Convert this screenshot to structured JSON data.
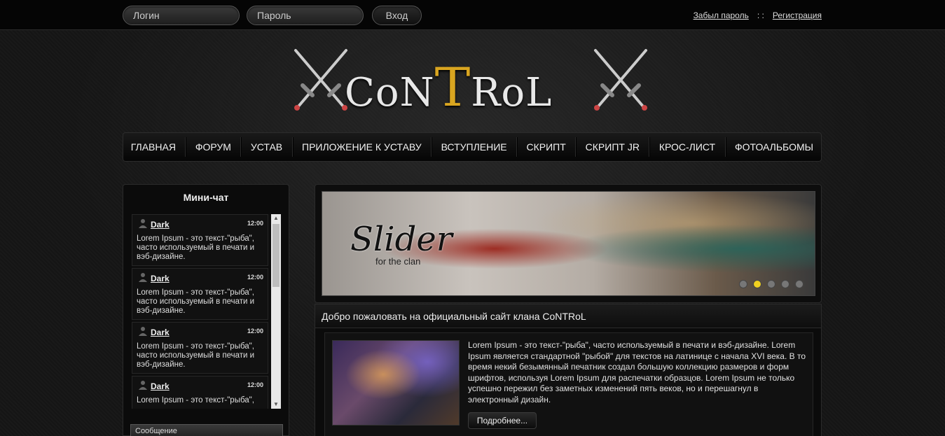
{
  "topbar": {
    "login_placeholder": "Логин",
    "password_placeholder": "Пароль",
    "login_button": "Вход",
    "forgot_password": "Забыл пароль",
    "separator": ": :",
    "register": "Регистрация"
  },
  "logo": {
    "part1": "CoN",
    "part2": "T",
    "part3": "RoL"
  },
  "nav": {
    "items": [
      "ГЛАВНАЯ",
      "ФОРУМ",
      "УСТАВ",
      "ПРИЛОЖЕНИЕ К УСТАВУ",
      "ВСТУПЛЕНИЕ",
      "СКРИПТ",
      "СКРИПТ JR",
      "КРОС-ЛИСТ",
      "ФОТОАЛЬБОМЫ"
    ]
  },
  "minichat": {
    "title": "Мини-чат",
    "messages": [
      {
        "user": "Dark",
        "time": "12:00",
        "text": "Lorem Ipsum - это текст-\"рыба\", часто используемый в печати и вэб-дизайне."
      },
      {
        "user": "Dark",
        "time": "12:00",
        "text": "Lorem Ipsum - это текст-\"рыба\", часто используемый в печати и вэб-дизайне."
      },
      {
        "user": "Dark",
        "time": "12:00",
        "text": "Lorem Ipsum - это текст-\"рыба\", часто используемый в печати и вэб-дизайне."
      },
      {
        "user": "Dark",
        "time": "12:00",
        "text": "Lorem Ipsum - это текст-\"рыба\","
      }
    ],
    "message_label": "Сообщение"
  },
  "slider": {
    "title": "Slider",
    "subtitle": "for the clan",
    "slide_count": 5,
    "active_slide": 2
  },
  "welcome": {
    "title": "Добро пожаловать на официальный сайт клана CoNTRoL",
    "text": "Lorem Ipsum - это текст-\"рыба\", часто используемый в печати и вэб-дизайне. Lorem Ipsum является стандартной \"рыбой\" для текстов на латинице с начала XVI века. В то время некий безымянный печатник создал большую коллекцию размеров и форм шрифтов, используя Lorem Ipsum для распечатки образцов. Lorem Ipsum не только успешно пережил без заметных изменений пять веков, но и перешагнул в электронный дизайн.",
    "more_button": "Подробнее..."
  },
  "colors": {
    "accent_gold": "#d9a520",
    "active_dot": "#f0d020"
  }
}
